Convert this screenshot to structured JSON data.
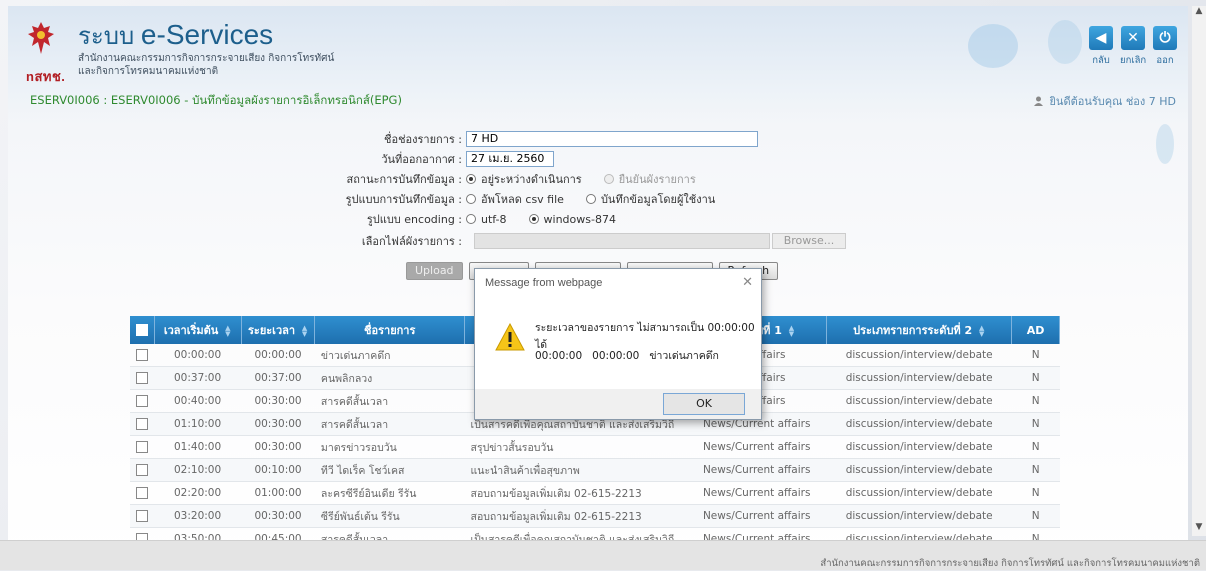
{
  "header": {
    "logo_text": "nสทช.",
    "title_prefix": "ระบบ ",
    "title": "e-Services",
    "subtitle_line1": "สำนักงานคณะกรรมการกิจการกระจายเสียง กิจการโทรทัศน์",
    "subtitle_line2": "และกิจการโทรคมนาคมแห่งชาติ",
    "buttons": [
      {
        "label": "กลับ",
        "icon": "back-arrow-icon",
        "glyph": "◀"
      },
      {
        "label": "ยกเลิก",
        "icon": "close-icon",
        "glyph": "✕"
      },
      {
        "label": "ออก",
        "icon": "power-icon",
        "glyph": "⏻"
      }
    ]
  },
  "breadcrumb": "ESERV0I006 : ESERV0I006 - บันทึกข้อมูลผังรายการอิเล็กทรอนิกส์(EPG)",
  "user_info": "ยินดีต้อนรับคุณ  ช่อง 7 HD",
  "form": {
    "channel_label": "ชื่อช่องรายการ :",
    "channel_value": "7 HD",
    "date_label": "วันที่ออกอากาศ :",
    "date_value": "27 เม.ย. 2560",
    "status_label": "สถานะการบันทึกข้อมูล :",
    "status_opt1": "อยู่ระหว่างดำเนินการ",
    "status_opt2": "ยืนยันผังรายการ",
    "mode_label": "รูปแบบการบันทึกข้อมูล :",
    "mode_opt1": "อัพโหลด csv file",
    "mode_opt2": "บันทึกข้อมูลโดยผู้ใช้งาน",
    "encoding_label": "รูปแบบ encoding :",
    "encoding_opt1": "utf-8",
    "encoding_opt2": "windows-874",
    "file_label": "เลือกไฟล์ผังรายการ :",
    "browse_label": "Browse...",
    "upload_label": "Upload",
    "refresh_label": "Refresh"
  },
  "table": {
    "headers": [
      "เวลาเริ่มต้น",
      "ระยะเวลา",
      "ชื่อรายการ",
      "ประเภทรายการระดับที่ 1",
      "ประเภทรายการระดับที่ 2",
      "AD"
    ],
    "header_col4_visible": "การระดับที่ 1",
    "rows": [
      {
        "start": "00:00:00",
        "dur": "00:00:00",
        "name": "ข่าวเด่นภาคดึก",
        "desc": "",
        "t1": "rent affairs",
        "t2": "discussion/interview/debate",
        "ad": "N"
      },
      {
        "start": "00:37:00",
        "dur": "00:37:00",
        "name": "คนพลิกลวง",
        "desc": "",
        "t1": "rent affairs",
        "t2": "discussion/interview/debate",
        "ad": "N"
      },
      {
        "start": "00:40:00",
        "dur": "00:30:00",
        "name": "สารคดีสั้นเวลา",
        "desc": "",
        "t1": "rent affairs",
        "t2": "discussion/interview/debate",
        "ad": "N"
      },
      {
        "start": "01:10:00",
        "dur": "00:30:00",
        "name": "สารคดีสั้นเวลา",
        "desc": "เป็นสารคดีเพื่อคุณสถาบันชาติ และส่งเสริมวิถี",
        "t1": "News/Current affairs",
        "t2": "discussion/interview/debate",
        "ad": "N"
      },
      {
        "start": "01:40:00",
        "dur": "00:30:00",
        "name": "มาตรข่าวรอบวัน",
        "desc": "สรุปข่าวสั้นรอบวัน",
        "t1": "News/Current affairs",
        "t2": "discussion/interview/debate",
        "ad": "N"
      },
      {
        "start": "02:10:00",
        "dur": "00:10:00",
        "name": "ทีวี ไดเร็ค โชว์เคส",
        "desc": "แนะนำสินค้าเพื่อสุขภาพ",
        "t1": "News/Current affairs",
        "t2": "discussion/interview/debate",
        "ad": "N"
      },
      {
        "start": "02:20:00",
        "dur": "01:00:00",
        "name": "ละครซีรีย์อินเดีย รีรัน",
        "desc": "สอบถามข้อมูลเพิ่มเติม 02-615-2213",
        "t1": "News/Current affairs",
        "t2": "discussion/interview/debate",
        "ad": "N"
      },
      {
        "start": "03:20:00",
        "dur": "00:30:00",
        "name": "ซีรีย์พันธ์เต้น รีรัน",
        "desc": "สอบถามข้อมูลเพิ่มเติม 02-615-2213",
        "t1": "News/Current affairs",
        "t2": "discussion/interview/debate",
        "ad": "N"
      },
      {
        "start": "03:50:00",
        "dur": "00:45:00",
        "name": "สารคดีสั้นเวลา",
        "desc": "เป็นสารคดีเพื่อคุณสถาบันชาติ และส่งเสริมวิถี",
        "t1": "News/Current affairs",
        "t2": "discussion/interview/debate",
        "ad": "N"
      }
    ]
  },
  "dialog": {
    "title": "Message from webpage",
    "message": "ระยะเวลาของรายการ ไม่สามารถเป็น 00:00:00 ได้",
    "detail_start": "00:00:00",
    "detail_dur": "00:00:00",
    "detail_name": "ข่าวเด่นภาคดึก",
    "ok_label": "OK"
  },
  "footer": "สำนักงานคณะกรรมการกิจการกระจายเสียง กิจการโทรทัศน์ และกิจการโทรคมนาคมแห่งชาติ"
}
